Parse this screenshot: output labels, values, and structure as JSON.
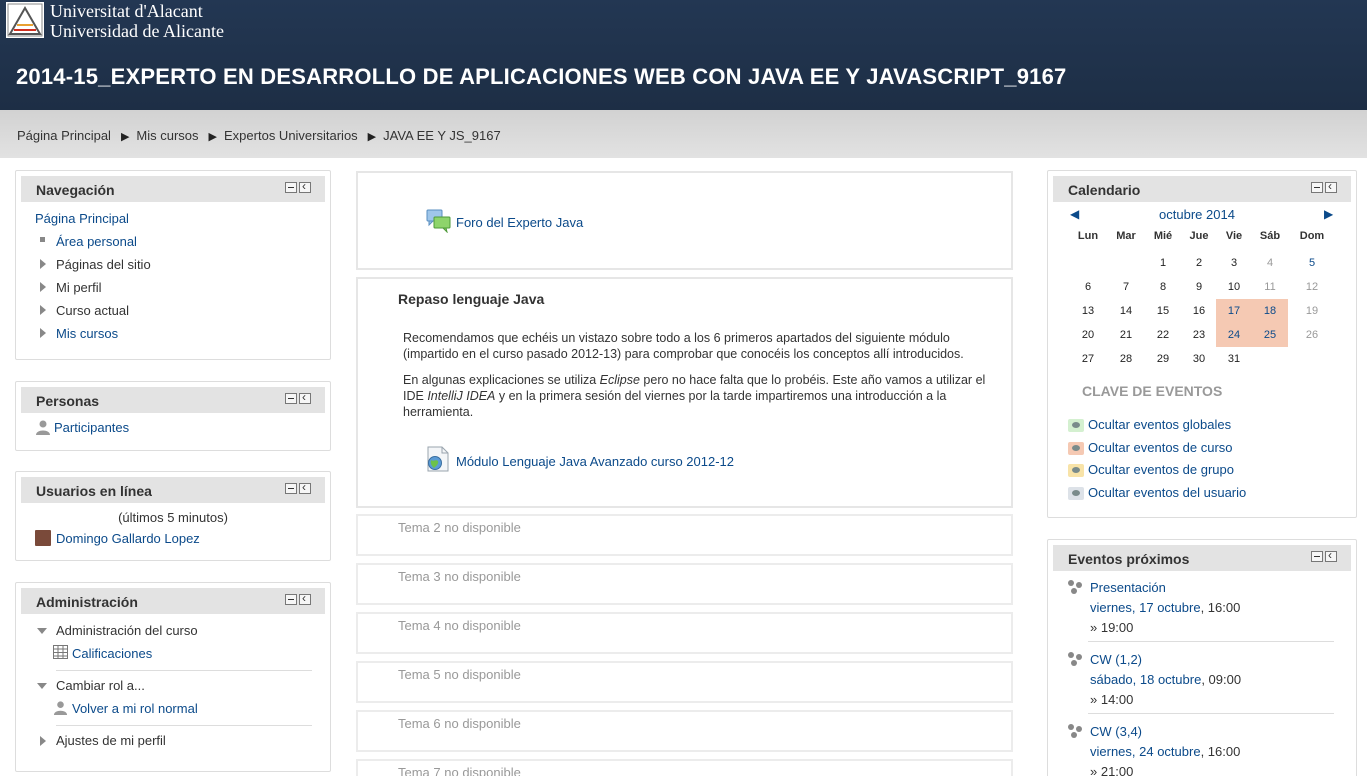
{
  "header": {
    "logo_line1": "Universitat d'Alacant",
    "logo_line2": "Universidad de Alicante",
    "course_title": "2014-15_EXPERTO EN DESARROLLO DE APLICACIONES WEB CON JAVA EE Y JAVASCRIPT_9167"
  },
  "breadcrumb": [
    "Página Principal",
    "Mis cursos",
    "Expertos Universitarios",
    "JAVA EE Y JS_9167"
  ],
  "navigation": {
    "title": "Navegación",
    "items": [
      "Página Principal",
      "Área personal",
      "Páginas del sitio",
      "Mi perfil",
      "Curso actual",
      "Mis cursos"
    ]
  },
  "personas": {
    "title": "Personas",
    "participants": "Participantes"
  },
  "online": {
    "title": "Usuarios en línea",
    "subtitle": "(últimos 5 minutos)",
    "user": "Domingo Gallardo Lopez"
  },
  "admin": {
    "title": "Administración",
    "course_admin": "Administración del curso",
    "grades": "Calificaciones",
    "switch_role": "Cambiar rol a...",
    "back_role": "Volver a mi rol normal",
    "profile_settings": "Ajustes de mi perfil"
  },
  "center": {
    "forum": "Foro del Experto Java",
    "section1_title": "Repaso lenguaje Java",
    "para1": "Recomendamos que echéis un vistazo sobre todo a los 6 primeros apartados del siguiente módulo (impartido en el curso pasado 2012-13) para comprobar que conocéis los conceptos allí introducidos.",
    "para2_a": "En algunas explicaciones se utiliza ",
    "para2_eclipse": "Eclipse",
    "para2_b": " pero no hace falta que lo probéis. Este año vamos a utilizar el IDE ",
    "para2_idea": "IntelliJ IDEA",
    "para2_c": " y en la primera sesión del viernes por la tarde impartiremos una introducción a la herramienta.",
    "module_link": "Módulo Lenguaje Java Avanzado curso 2012-12",
    "unavailable": [
      "Tema 2 no disponible",
      "Tema 3 no disponible",
      "Tema 4 no disponible",
      "Tema 5 no disponible",
      "Tema 6 no disponible",
      "Tema 7 no disponible"
    ]
  },
  "calendar": {
    "title": "Calendario",
    "month": "octubre 2014",
    "weekdays": [
      "Lun",
      "Mar",
      "Mié",
      "Jue",
      "Vie",
      "Sáb",
      "Dom"
    ],
    "key_title": "CLAVE DE EVENTOS",
    "key_items": [
      {
        "label": "Ocultar eventos globales",
        "color": "#d4f0d0"
      },
      {
        "label": "Ocultar eventos de curso",
        "color": "#f5c9b3"
      },
      {
        "label": "Ocultar eventos de grupo",
        "color": "#f8e3a8"
      },
      {
        "label": "Ocultar eventos del usuario",
        "color": "#dde2e8"
      }
    ]
  },
  "upcoming": {
    "title": "Eventos próximos",
    "events": [
      {
        "name": "Presentación",
        "date": "viernes, 17 octubre",
        "start": ", 16:00",
        "end": "» 19:00"
      },
      {
        "name": "CW (1,2)",
        "date": "sábado, 18 octubre",
        "start": ", 09:00",
        "end": "» 14:00"
      },
      {
        "name": "CW (3,4)",
        "date": "viernes, 24 octubre",
        "start": ", 16:00",
        "end": "» 21:00"
      }
    ]
  }
}
